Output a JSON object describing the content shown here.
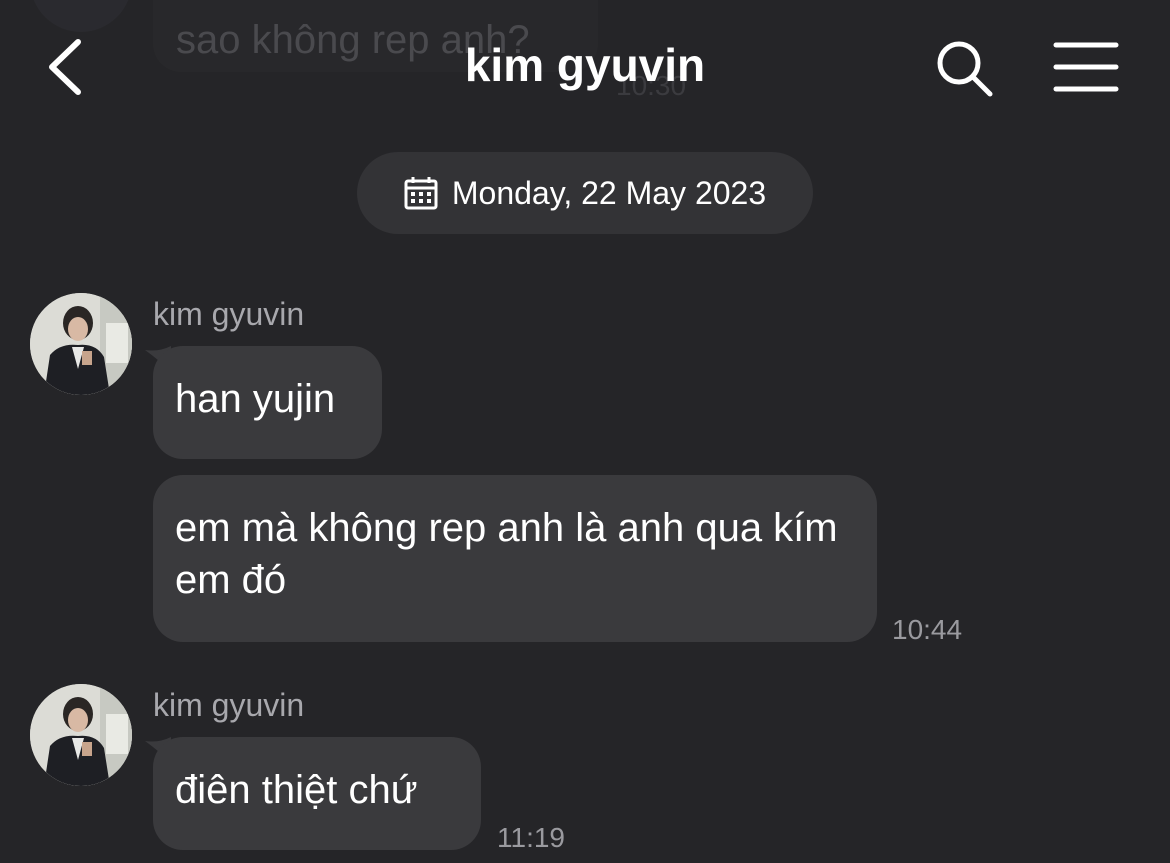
{
  "header": {
    "title": "kim gyuvin"
  },
  "ghost": {
    "text": "sao không rep anh?",
    "time": "10:30"
  },
  "date_divider": {
    "label": "Monday, 22 May 2023"
  },
  "messages": [
    {
      "sender": "kim gyuvin",
      "bubbles": [
        "han yujin",
        "em mà không rep anh là anh qua kím em đó"
      ],
      "time": "10:44"
    },
    {
      "sender": "kim gyuvin",
      "bubbles": [
        "điên thiệt chứ"
      ],
      "time": "11:19"
    }
  ],
  "icons": {
    "back": "chevron-left-icon",
    "search": "search-icon",
    "menu": "hamburger-menu-icon",
    "calendar": "calendar-icon"
  },
  "colors": {
    "background": "#252528",
    "bubble": "#3a3a3d",
    "pill": "#333336",
    "secondary_text": "#a8a8ad"
  }
}
